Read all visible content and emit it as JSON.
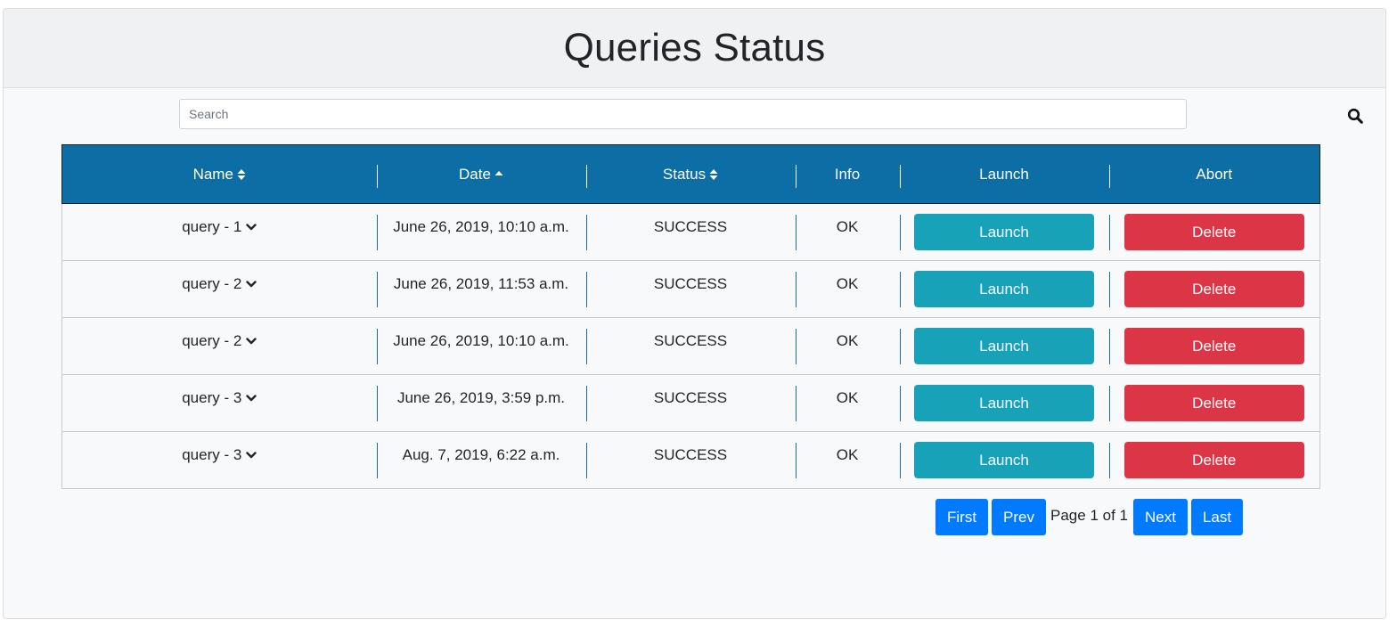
{
  "header": {
    "title": "Queries Status"
  },
  "search": {
    "placeholder": "Search",
    "value": "",
    "icon": "search-icon"
  },
  "table": {
    "columns": [
      {
        "label": "Name",
        "sort": "both"
      },
      {
        "label": "Date",
        "sort": "up"
      },
      {
        "label": "Status",
        "sort": "both"
      },
      {
        "label": "Info",
        "sort": "none"
      },
      {
        "label": "Launch",
        "sort": "none"
      },
      {
        "label": "Abort",
        "sort": "none"
      }
    ],
    "rows": [
      {
        "name": "query - 1",
        "date": "June 26, 2019, 10:10 a.m.",
        "status": "SUCCESS",
        "info": "OK",
        "launch": "Launch",
        "abort": "Delete"
      },
      {
        "name": "query - 2",
        "date": "June 26, 2019, 11:53 a.m.",
        "status": "SUCCESS",
        "info": "OK",
        "launch": "Launch",
        "abort": "Delete"
      },
      {
        "name": "query - 2",
        "date": "June 26, 2019, 10:10 a.m.",
        "status": "SUCCESS",
        "info": "OK",
        "launch": "Launch",
        "abort": "Delete"
      },
      {
        "name": "query - 3",
        "date": "June 26, 2019, 3:59 p.m.",
        "status": "SUCCESS",
        "info": "OK",
        "launch": "Launch",
        "abort": "Delete"
      },
      {
        "name": "query - 3",
        "date": "Aug. 7, 2019, 6:22 a.m.",
        "status": "SUCCESS",
        "info": "OK",
        "launch": "Launch",
        "abort": "Delete"
      }
    ]
  },
  "pagination": {
    "first": "First",
    "prev": "Prev",
    "info": "Page 1 of 1",
    "next": "Next",
    "last": "Last"
  },
  "colors": {
    "header_bg": "#0d6ea5",
    "launch": "#17a2b8",
    "delete": "#dc3545",
    "pager": "#007bff"
  }
}
